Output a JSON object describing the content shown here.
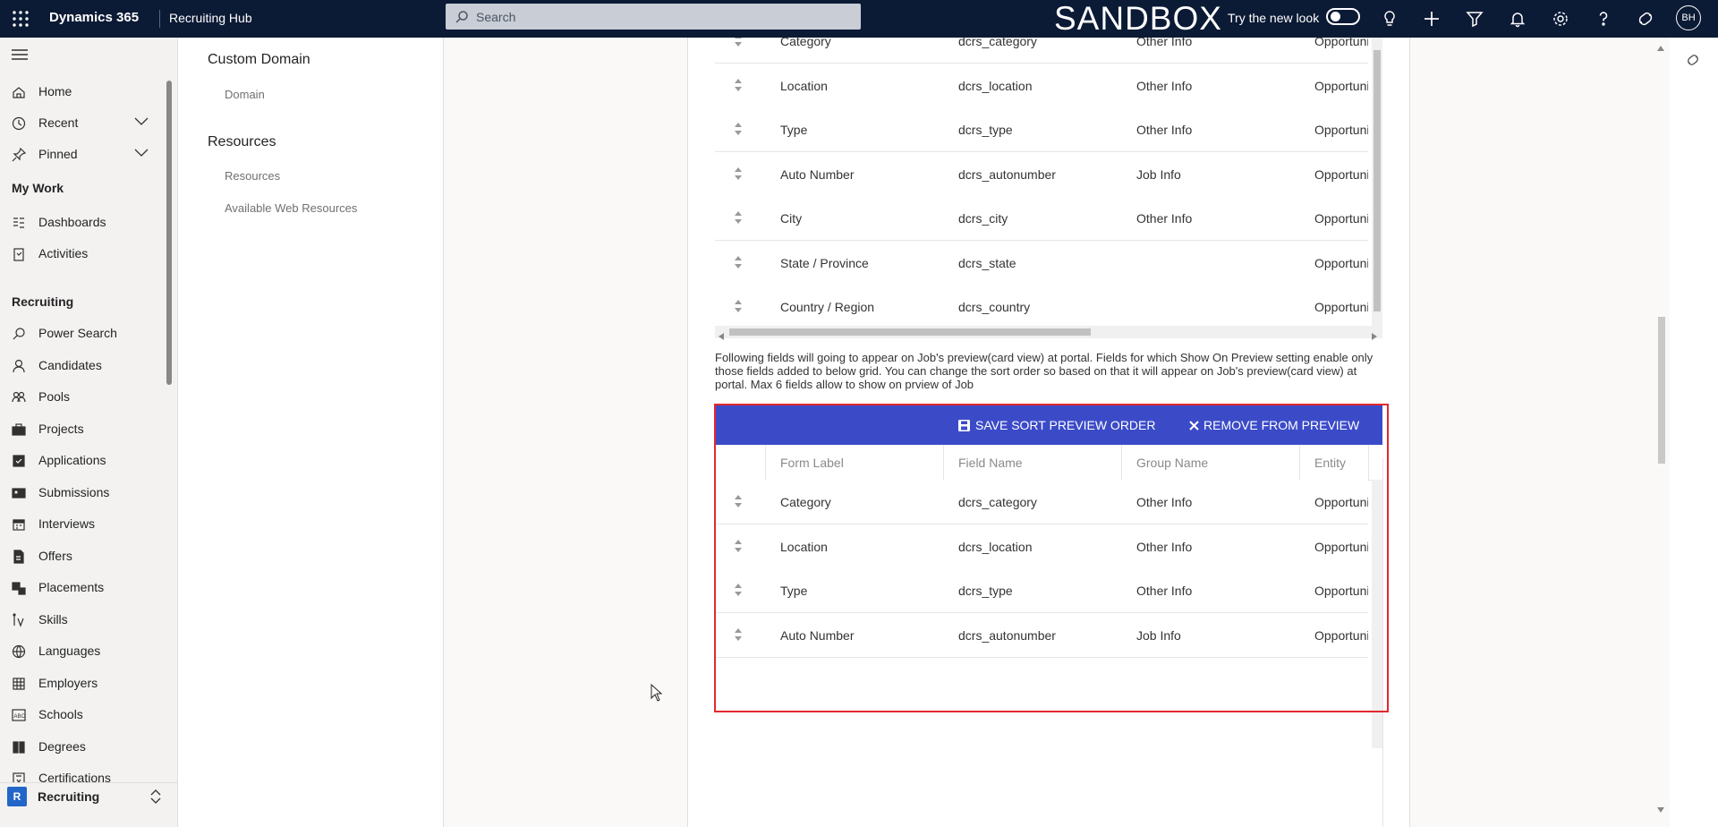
{
  "topbar": {
    "brand": "Dynamics 365",
    "app_name": "Recruiting Hub",
    "search_placeholder": "Search",
    "environment": "SANDBOX",
    "try_new_look": "Try the new look",
    "avatar_initials": "BH"
  },
  "leftnav": {
    "items_top": [
      {
        "label": "Home",
        "icon": "home-icon"
      },
      {
        "label": "Recent",
        "icon": "clock-icon"
      },
      {
        "label": "Pinned",
        "icon": "pin-icon"
      }
    ],
    "my_work_header": "My Work",
    "my_work": [
      {
        "label": "Dashboards",
        "icon": "dashboard-icon"
      },
      {
        "label": "Activities",
        "icon": "clipboard-icon"
      }
    ],
    "recruiting_header": "Recruiting",
    "recruiting": [
      {
        "label": "Power Search",
        "icon": "search-icon"
      },
      {
        "label": "Candidates",
        "icon": "person-icon"
      },
      {
        "label": "Pools",
        "icon": "people-icon"
      },
      {
        "label": "Projects",
        "icon": "briefcase-icon"
      },
      {
        "label": "Applications",
        "icon": "checkbox-icon"
      },
      {
        "label": "Submissions",
        "icon": "idcard-icon"
      },
      {
        "label": "Interviews",
        "icon": "calendar-icon"
      },
      {
        "label": "Offers",
        "icon": "document-icon"
      },
      {
        "label": "Placements",
        "icon": "placement-icon"
      },
      {
        "label": "Skills",
        "icon": "skills-icon"
      },
      {
        "label": "Languages",
        "icon": "globe-icon"
      },
      {
        "label": "Employers",
        "icon": "building-icon"
      },
      {
        "label": "Schools",
        "icon": "abc-icon"
      },
      {
        "label": "Degrees",
        "icon": "book-icon"
      },
      {
        "label": "Certifications",
        "icon": "certificate-icon"
      }
    ],
    "area_badge": "R",
    "area_label": "Recruiting"
  },
  "subnav": {
    "custom_domain_header": "Custom Domain",
    "domain_link": "Domain",
    "resources_header": "Resources",
    "resources_link": "Resources",
    "web_resources_link": "Available Web Resources"
  },
  "grid1": {
    "rows": [
      {
        "label": "Category",
        "field": "dcrs_category",
        "group": "Other Info",
        "entity": "Opportunity"
      },
      {
        "label": "Location",
        "field": "dcrs_location",
        "group": "Other Info",
        "entity": "Opportunity"
      },
      {
        "label": "Type",
        "field": "dcrs_type",
        "group": "Other Info",
        "entity": "Opportunity"
      },
      {
        "label": "Auto Number",
        "field": "dcrs_autonumber",
        "group": "Job Info",
        "entity": "Opportunity"
      },
      {
        "label": "City",
        "field": "dcrs_city",
        "group": "Other Info",
        "entity": "Opportunity"
      },
      {
        "label": "State / Province",
        "field": "dcrs_state",
        "group": "",
        "entity": "Opportunity"
      },
      {
        "label": "Country / Region",
        "field": "dcrs_country",
        "group": "",
        "entity": "Opportunity"
      }
    ]
  },
  "help_text": "Following fields will going to appear on Job's preview(card view) at portal. Fields for which Show On Preview setting enable only those fields added to below grid. You can change the sort order so based on that it will appear on Job's preview(card view) at portal. Max 6 fields allow to show on prview of Job",
  "preview": {
    "save_label": "SAVE SORT PREVIEW ORDER",
    "remove_label": "REMOVE FROM PREVIEW",
    "headers": {
      "label": "Form Label",
      "field": "Field Name",
      "group": "Group Name",
      "entity": "Entity"
    },
    "rows": [
      {
        "label": "Category",
        "field": "dcrs_category",
        "group": "Other Info",
        "entity": "Opportunity"
      },
      {
        "label": "Location",
        "field": "dcrs_location",
        "group": "Other Info",
        "entity": "Opportunity"
      },
      {
        "label": "Type",
        "field": "dcrs_type",
        "group": "Other Info",
        "entity": "Opportunity"
      },
      {
        "label": "Auto Number",
        "field": "dcrs_autonumber",
        "group": "Job Info",
        "entity": "Opportunity"
      }
    ]
  },
  "colors": {
    "topbar": "#0b1a35",
    "toolbar": "#3b4bc8",
    "highlight": "#e0292f"
  }
}
